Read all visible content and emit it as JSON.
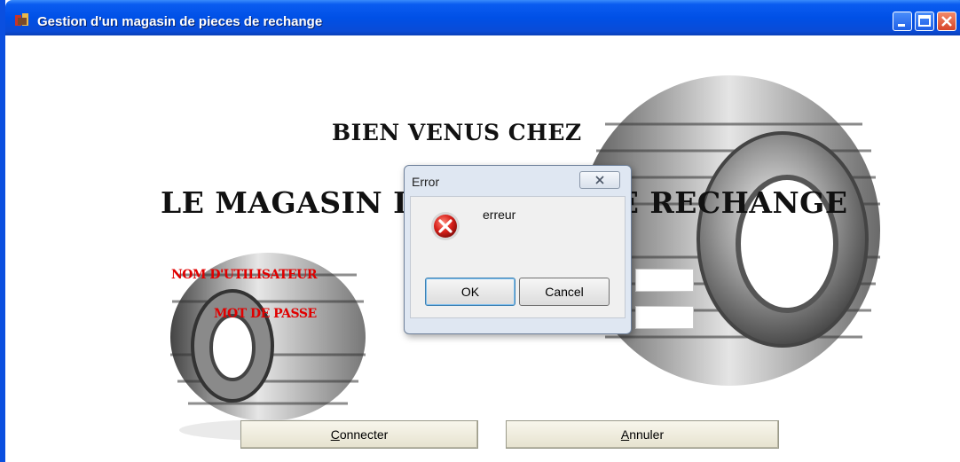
{
  "window": {
    "title": "Gestion d'un magasin de pieces de rechange",
    "controls": [
      "minimize",
      "maximize",
      "close"
    ]
  },
  "main": {
    "heading_line1": "Bien venus chez",
    "heading_line2": "le magasin de pieces de rechange",
    "username_label": "Nom d'utilisateur",
    "password_label": "Mot de passe",
    "username_value": "",
    "password_value": "",
    "connect_button": {
      "mnemonic": "C",
      "rest": "onnecter"
    },
    "cancel_button": {
      "mnemonic": "A",
      "rest": "nnuler"
    }
  },
  "dialog": {
    "title": "Error",
    "message": "erreur",
    "ok_label": "OK",
    "cancel_label": "Cancel",
    "icon": "error-icon"
  },
  "colors": {
    "titlebar": "#0050e6",
    "label_red": "#e00000",
    "dialog_bg": "#dfe7f2"
  }
}
